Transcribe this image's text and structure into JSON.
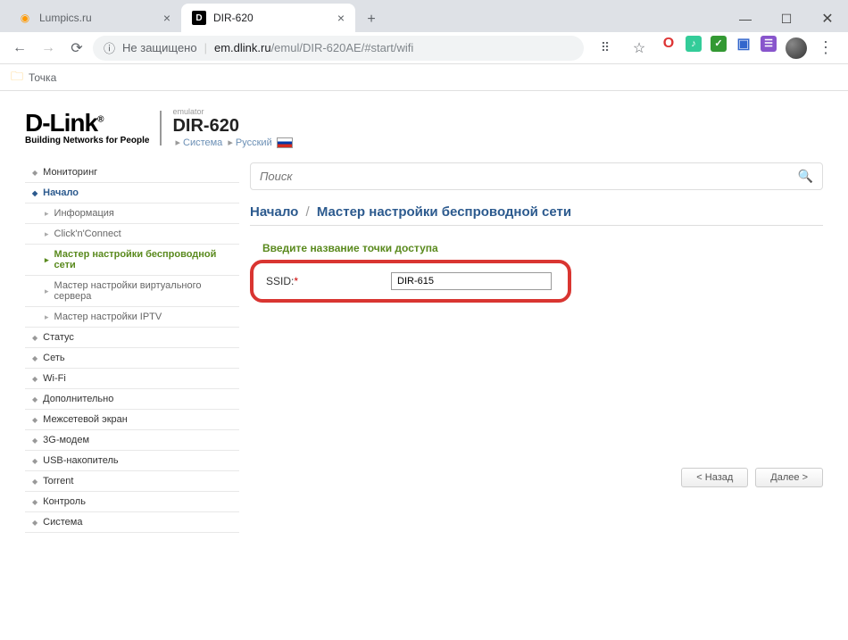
{
  "window": {
    "minimize": "—",
    "maximize": "☐",
    "close": "✕"
  },
  "tabs": [
    {
      "title": "Lumpics.ru",
      "active": false
    },
    {
      "title": "DIR-620",
      "active": true
    }
  ],
  "address": {
    "insecure_label": "Не защищено",
    "host": "em.dlink.ru",
    "path": "/emul/DIR-620AE/#start/wifi"
  },
  "bookmarks": {
    "item1": "Точка"
  },
  "header": {
    "logo_main": "D-Link",
    "logo_sub": "Building Networks for People",
    "emulator": "emulator",
    "model": "DIR-620",
    "bc_system": "Система",
    "bc_lang": "Русский"
  },
  "sidebar": {
    "monitoring": "Мониторинг",
    "start": "Начало",
    "sub_info": "Информация",
    "sub_click": "Click'n'Connect",
    "sub_wifi": "Мастер настройки беспроводной сети",
    "sub_vserver": "Мастер настройки виртуального сервера",
    "sub_iptv": "Мастер настройки IPTV",
    "status": "Статус",
    "net": "Сеть",
    "wifi": "Wi-Fi",
    "additional": "Дополнительно",
    "firewall": "Межсетевой экран",
    "modem": "3G-модем",
    "usb": "USB-накопитель",
    "torrent": "Torrent",
    "control": "Контроль",
    "system": "Система"
  },
  "search": {
    "placeholder": "Поиск"
  },
  "breadcrumb": {
    "root": "Начало",
    "current": "Мастер настройки беспроводной сети"
  },
  "form": {
    "section_title": "Введите название точки доступа",
    "ssid_label": "SSID:",
    "ssid_value": "DIR-615"
  },
  "buttons": {
    "back": "< Назад",
    "next": "Далее >"
  }
}
